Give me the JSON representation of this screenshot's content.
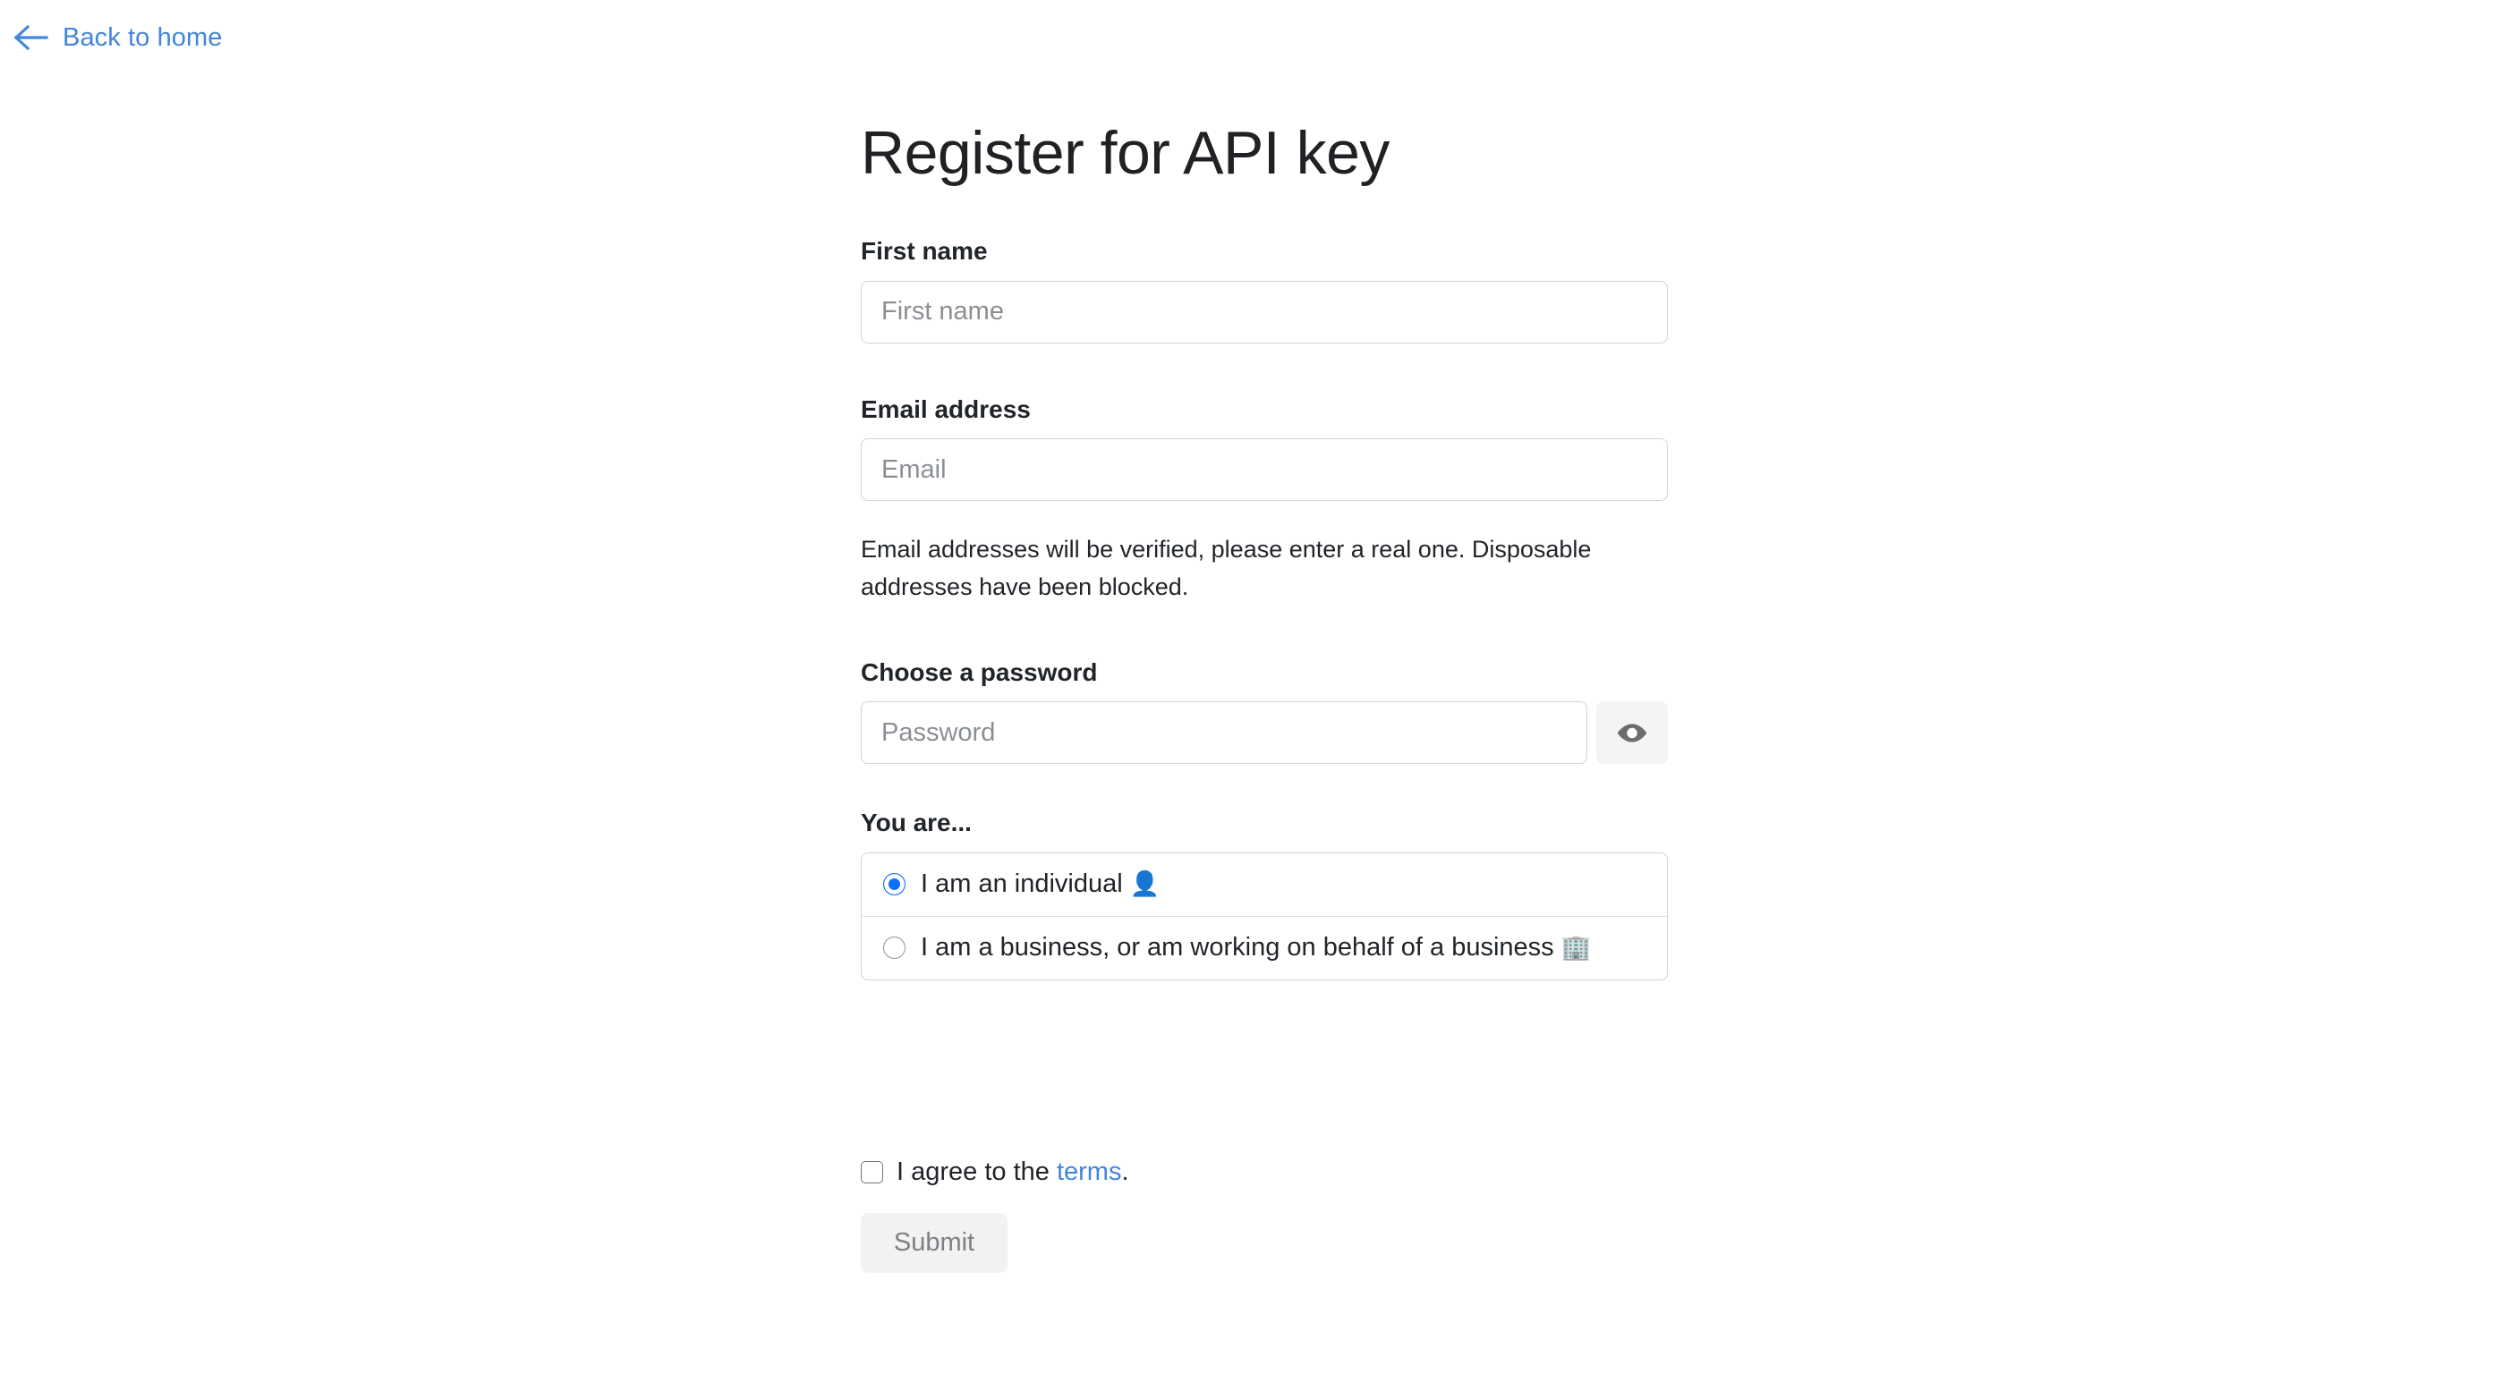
{
  "back_link": {
    "label": "Back to home",
    "icon": "arrow-left-icon",
    "color": "#4285dd"
  },
  "page": {
    "title": "Register for API key"
  },
  "fields": {
    "first_name": {
      "label": "First name",
      "placeholder": "First name",
      "value": ""
    },
    "email": {
      "label": "Email address",
      "placeholder": "Email",
      "value": "",
      "help": "Email addresses will be verified, please enter a real one. Disposable addresses have been blocked."
    },
    "password": {
      "label": "Choose a password",
      "placeholder": "Password",
      "value": "",
      "toggle_icon": "eye-icon"
    }
  },
  "account_type": {
    "label": "You are...",
    "options": [
      {
        "text": "I am an individual",
        "emoji": "👤",
        "emoji_name": "person-icon",
        "selected": true
      },
      {
        "text": "I am a business, or am working on behalf of a business",
        "emoji": "🏢",
        "emoji_name": "office-building-icon",
        "selected": false
      }
    ]
  },
  "terms": {
    "prefix": "I agree to the ",
    "link_label": "terms",
    "suffix": ".",
    "checked": false
  },
  "submit": {
    "label": "Submit",
    "enabled": false
  },
  "colors": {
    "link": "#4285dd",
    "radio_selected": "#0b6ff7",
    "border": "#ced4da",
    "button_bg": "#f2f2f2",
    "button_text": "#7c8084"
  }
}
